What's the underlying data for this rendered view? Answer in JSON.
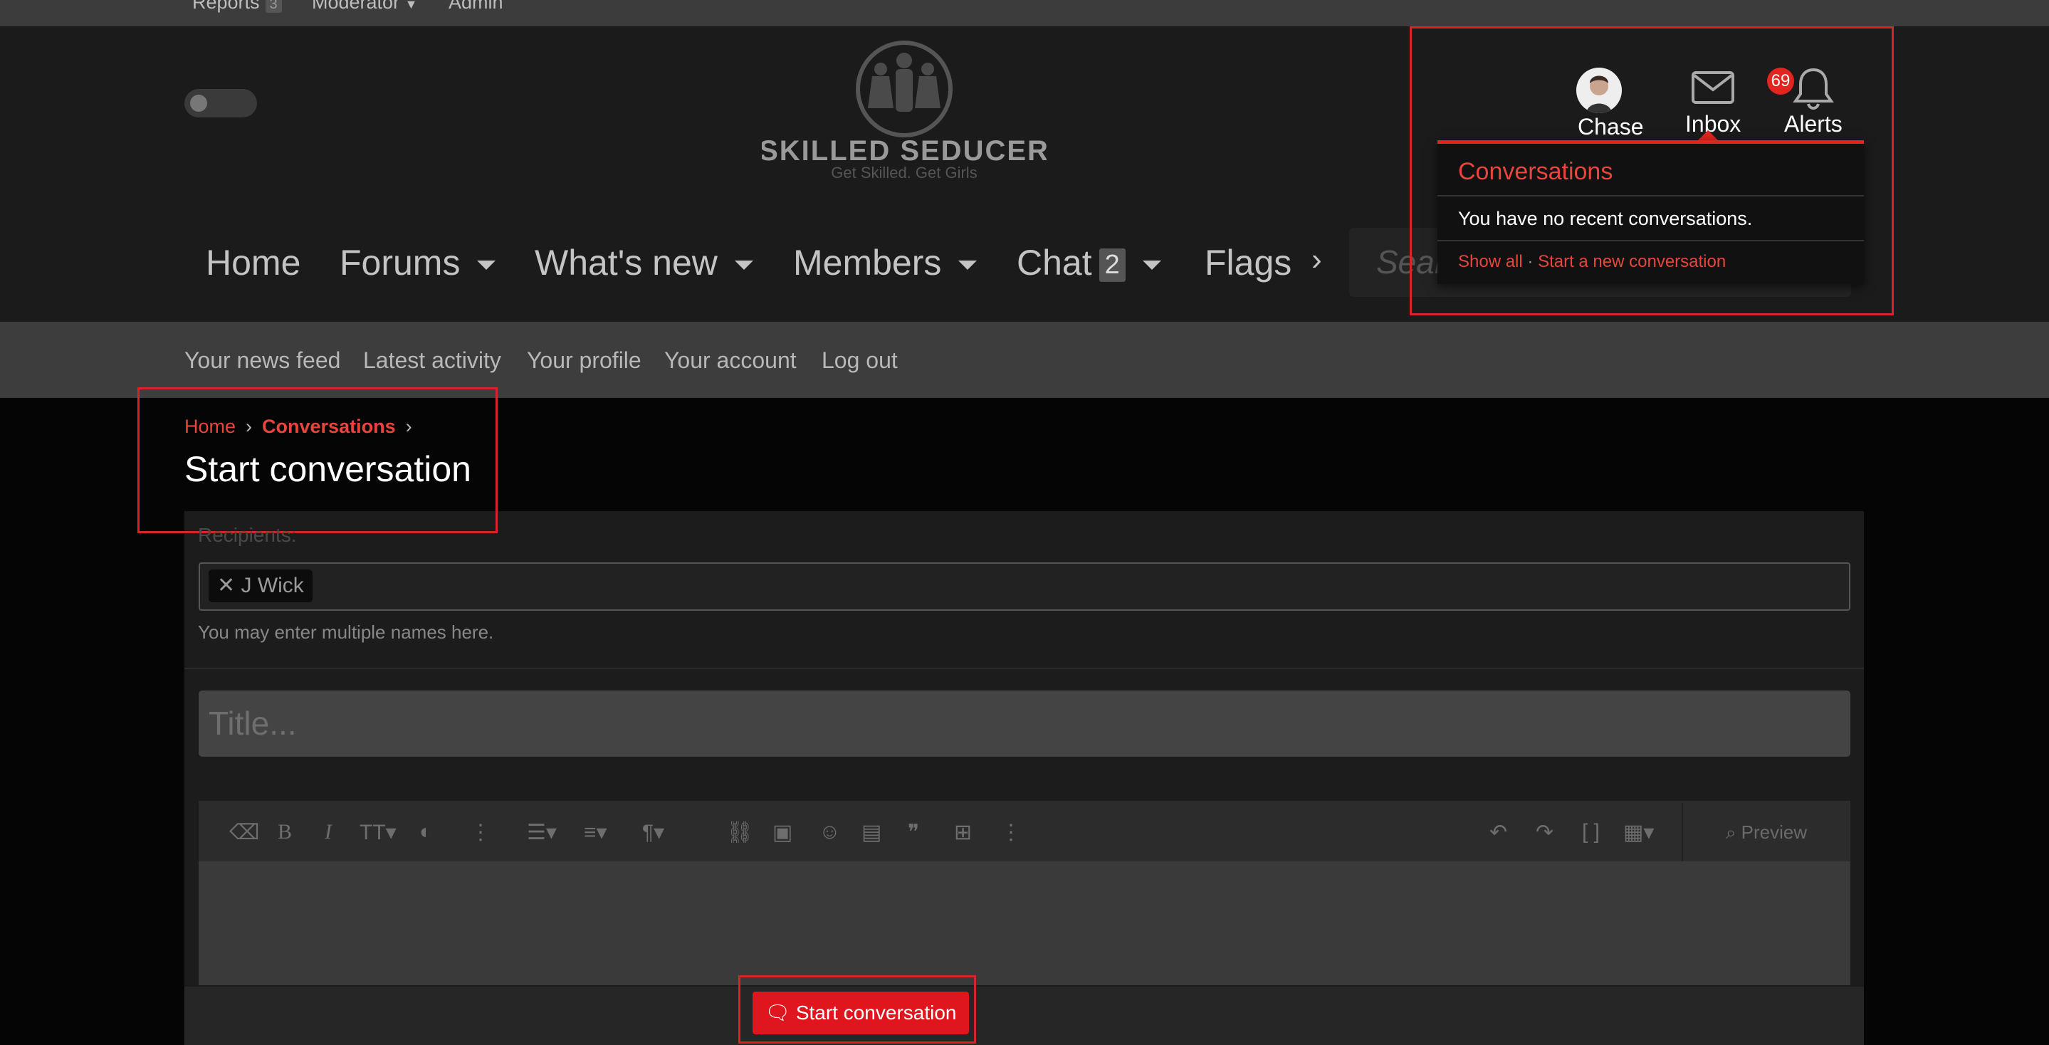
{
  "staff_bar": {
    "reports_label": "Reports",
    "reports_count": "3",
    "moderator_label": "Moderator",
    "admin_label": "Admin"
  },
  "logo": {
    "title": "SKILLED SEDUCER",
    "tagline": "Get Skilled. Get Girls"
  },
  "nav": {
    "tabs": [
      {
        "label": "Home"
      },
      {
        "label": "Forums"
      },
      {
        "label": "What's new"
      },
      {
        "label": "Members"
      },
      {
        "label": "Chat",
        "badge": "2"
      },
      {
        "label": "Flags"
      }
    ],
    "search_placeholder": "Search"
  },
  "subnav": {
    "items": [
      "Your news feed",
      "Latest activity",
      "Your profile",
      "Your account",
      "Log out"
    ]
  },
  "user_area": {
    "user_name": "Chase",
    "inbox_label": "Inbox",
    "alerts_label": "Alerts",
    "alerts_count": "69"
  },
  "conversations_menu": {
    "title": "Conversations",
    "empty_text": "You have no recent conversations.",
    "show_all": "Show all",
    "separator": "·",
    "start_new": "Start a new conversation"
  },
  "breadcrumb": {
    "home": "Home",
    "conversations": "Conversations"
  },
  "page_title": "Start conversation",
  "form": {
    "recipients_label": "Recipients:",
    "recipient_token": "J Wick",
    "recipients_hint": "You may enter multiple names here.",
    "title_placeholder": "Title...",
    "preview_label": "Preview",
    "submit_label": "Start conversation"
  },
  "colors": {
    "accent": "#e8453c",
    "button_red": "#e0161f",
    "highlight_border": "#d8232a"
  }
}
